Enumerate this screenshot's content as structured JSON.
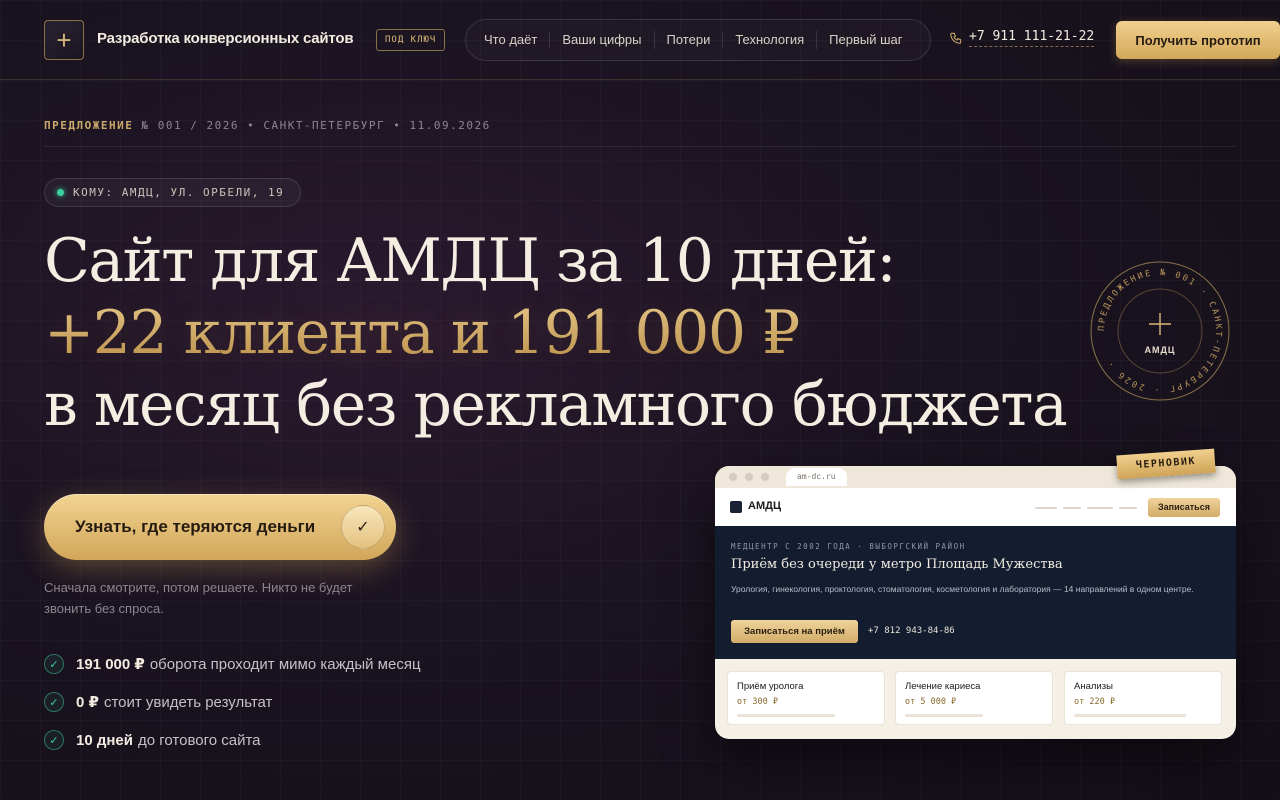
{
  "header": {
    "brand": "Разработка конверсионных сайтов",
    "badge": "ПОД КЛЮЧ",
    "nav": [
      "Что даёт",
      "Ваши цифры",
      "Потери",
      "Технология",
      "Первый шаг"
    ],
    "phone": "+7 911 111-21-22",
    "cta": "Получить прототип"
  },
  "meta": {
    "label": "ПРЕДЛОЖЕНИЕ",
    "rest": "№ 001 / 2026 • САНКТ-ПЕТЕРБУРГ • 11.09.2026"
  },
  "recipient": "КОМУ: АМДЦ, УЛ. ОРБЕЛИ, 19",
  "headline": {
    "line1": "Сайт для АМДЦ за 10 дней:",
    "line2": "+22 клиента и 191 000 ₽",
    "line3": "в месяц без рекламного бюджета"
  },
  "stamp": {
    "ring_text": "ПРЕДЛОЖЕНИЕ № 001 · САНКТ-ПЕТЕРБУРГ · 2026 ·",
    "center": "АМДЦ"
  },
  "cta": {
    "label": "Узнать, где теряются деньги",
    "note": "Сначала смотрите, потом решаете. Никто не будет звонить без спроса."
  },
  "benefits": [
    {
      "strong": "191 000 ₽",
      "rest": "оборота проходит мимо каждый месяц"
    },
    {
      "strong": "0 ₽",
      "rest": "стоит увидеть результат"
    },
    {
      "strong": "10 дней",
      "rest": "до готового сайта"
    }
  ],
  "mock": {
    "badge": "ЧЕРНОВИК",
    "url": "am-dc.ru",
    "logo": "АМДЦ",
    "book": "Записаться",
    "eyebrow": "МЕДЦЕНТР С 2002 ГОДА · ВЫБОРГСКИЙ РАЙОН",
    "title": "Приём без очереди у метро Площадь Мужества",
    "desc": "Урология, гинекология, проктология, стоматология, косметология и лаборатория — 14 направлений в одном центре.",
    "cta": "Записаться на приём",
    "phone": "+7 812 943-84-86",
    "cards": [
      {
        "title": "Приём уролога",
        "price": "от 300 ₽"
      },
      {
        "title": "Лечение кариеса",
        "price": "от 5 000 ₽"
      },
      {
        "title": "Анализы",
        "price": "от 220 ₽"
      }
    ]
  },
  "colors": {
    "accent": "#d4a85a",
    "success": "#3ed0a0",
    "background": "#1a1320"
  },
  "icons": {
    "logo": "plus-icon",
    "phone": "phone-icon",
    "cta": "check-icon",
    "benefit": "check-icon"
  }
}
